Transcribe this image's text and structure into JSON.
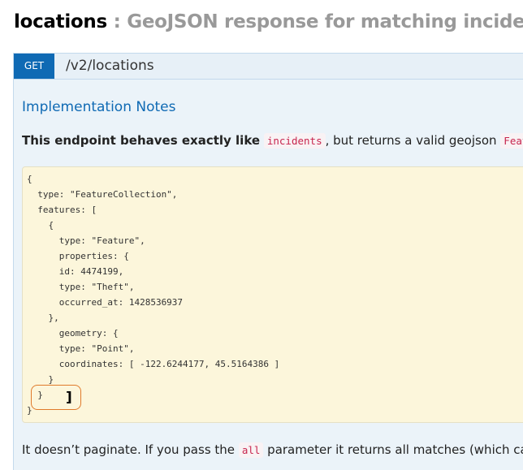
{
  "header": {
    "path": "locations",
    "separator": ":",
    "description": "GeoJSON response for matching incidents"
  },
  "operation": {
    "method": "GET",
    "path": "/v2/locations",
    "colors": {
      "method_get": "#0f6ab4",
      "panel_bg": "#ebf3f9",
      "code_bg": "#fcf6db",
      "highlight": "#e07a2b"
    }
  },
  "notes": {
    "title": "Implementation Notes",
    "intro_bold": "This endpoint behaves exactly like",
    "intro_code1": "incidents",
    "intro_rest": ", but returns a valid geojson",
    "intro_code2": "Feature",
    "code_lines": [
      "{",
      "  type: \"FeatureCollection\",",
      "  features: [",
      "    {",
      "      type: \"Feature\",",
      "      properties: {",
      "      id: 4474199,",
      "      type: \"Theft\",",
      "      occurred_at: 1428536937",
      "    },",
      "      geometry: {",
      "      type: \"Point\",",
      "      coordinates: [ -122.6244177, 45.5164386 ]",
      "    }",
      "  }",
      "}"
    ],
    "stray_bracket": "]",
    "outro_before": "It doesn’t paginate. If you pass the",
    "outro_code": "all",
    "outro_after": "parameter it returns all matches (which can b"
  }
}
